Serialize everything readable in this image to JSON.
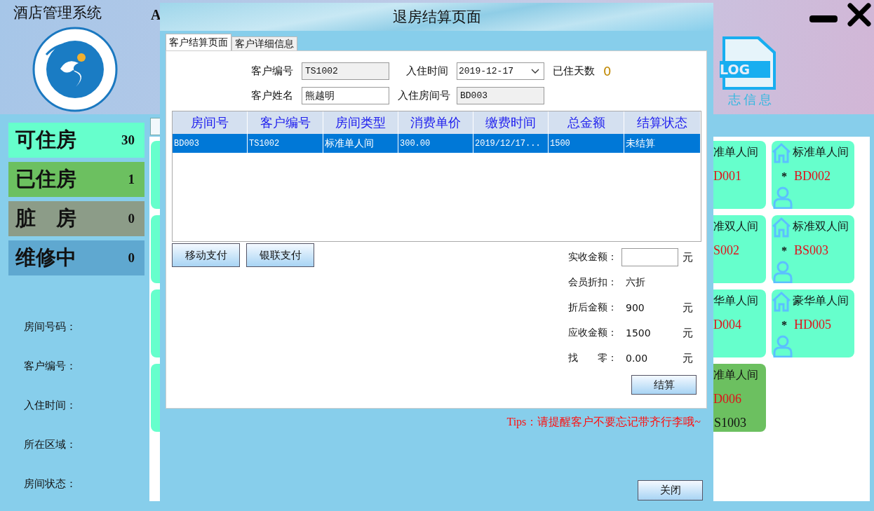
{
  "app": {
    "title": "酒店管理系统",
    "header_text": "A",
    "log_badge": "LOG",
    "log_caption": "志信息"
  },
  "stats": [
    {
      "label": "可住房",
      "count": "30",
      "color": "#66ffcc"
    },
    {
      "label": "已住房",
      "count": "1",
      "color": "#6cc060"
    },
    {
      "label": "脏　房",
      "count": "0",
      "color": "#8c9c88"
    },
    {
      "label": "维修中",
      "count": "0",
      "color": "#5fa8d0"
    }
  ],
  "detail_labels": [
    "房间号码：",
    "客户编号：",
    "入住时间：",
    "所在区域：",
    "房间状态："
  ],
  "room_columns": [
    {
      "kind": "clipped",
      "rooms": [
        {
          "type": "准单人间",
          "number": "D001",
          "color": "#66ffcc"
        },
        {
          "type": "准双人间",
          "number": "S002",
          "color": "#66ffcc"
        },
        {
          "type": "华单人间",
          "number": "D004",
          "color": "#66ffcc"
        },
        {
          "type": "准单人间",
          "number": "D006",
          "guest": "S1003",
          "color": "#6cc060"
        }
      ]
    },
    {
      "kind": "full",
      "rooms": [
        {
          "type": "标准单人间",
          "marker": "*",
          "number": "BD002",
          "color": "#66ffcc"
        },
        {
          "type": "标准双人间",
          "marker": "*",
          "number": "BS003",
          "color": "#66ffcc"
        },
        {
          "type": "豪华单人间",
          "marker": "*",
          "number": "HD005",
          "color": "#66ffcc"
        }
      ]
    }
  ],
  "dialog": {
    "title": "退房结算页面",
    "tabs": [
      {
        "label": "客户结算页面",
        "selected": true
      },
      {
        "label": "客户详细信息",
        "selected": false
      }
    ],
    "form": {
      "customer_id": {
        "label": "客户编号",
        "value": "TS1002",
        "readonly": true
      },
      "checkin_time": {
        "label": "入住时间",
        "value": "2019-12-17"
      },
      "days": {
        "label": "已住天数",
        "value": "0"
      },
      "customer_name": {
        "label": "客户姓名",
        "value": "熊越明",
        "readonly": false
      },
      "room": {
        "label": "入住房间号",
        "value": "BD003",
        "readonly": true
      }
    },
    "table": {
      "columns": [
        "房间号",
        "客户编号",
        "房间类型",
        "消费单价",
        "缴费时间",
        "总金额",
        "结算状态"
      ],
      "rows": [
        {
          "cells": [
            "BD003",
            "TS1002",
            "标准单人间",
            "300.00",
            "2019/12/17...",
            "1500",
            "未结算"
          ],
          "selected": true
        }
      ]
    },
    "pay_buttons": [
      "移动支付",
      "银联支付"
    ],
    "summary": [
      {
        "kind": "input",
        "label": "实收金额：",
        "unit": "元"
      },
      {
        "kind": "text",
        "label": "会员折扣：",
        "value": "六折"
      },
      {
        "kind": "text",
        "label": "折后金额：",
        "value": "900",
        "unit": "元"
      },
      {
        "kind": "text",
        "label": "应收金额：",
        "value": "1500",
        "unit": "元"
      },
      {
        "kind": "text",
        "label": "找　　零：",
        "value": "0.00",
        "unit": "元"
      }
    ],
    "settle_button": "结算",
    "tip": "Tips：请提醒客户不要忘记带齐行李哦~",
    "close_button": "关闭"
  }
}
